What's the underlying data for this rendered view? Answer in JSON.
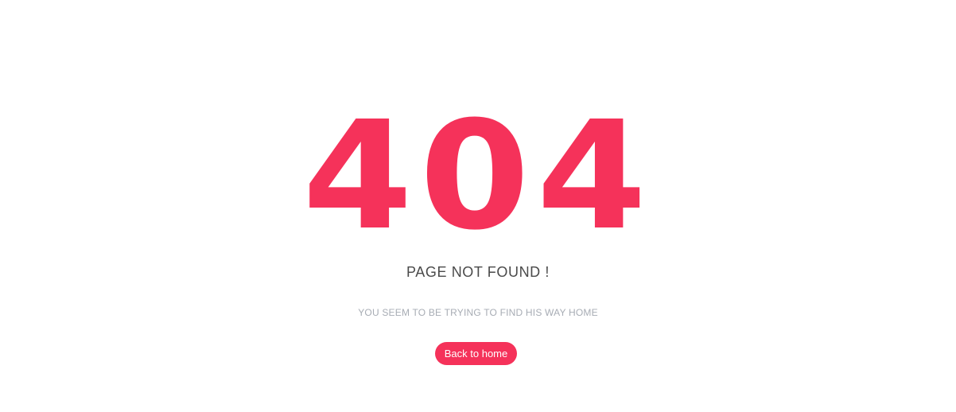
{
  "error_code": "404",
  "headline": "PAGE NOT FOUND !",
  "subtext": "YOU SEEM TO BE TRYING TO FIND HIS WAY HOME",
  "back_button": {
    "label": "Back to home"
  },
  "colors": {
    "accent": "#f5325a",
    "headline_text": "#4a4a4a",
    "subtext": "#a7acb4",
    "background": "#ffffff"
  }
}
